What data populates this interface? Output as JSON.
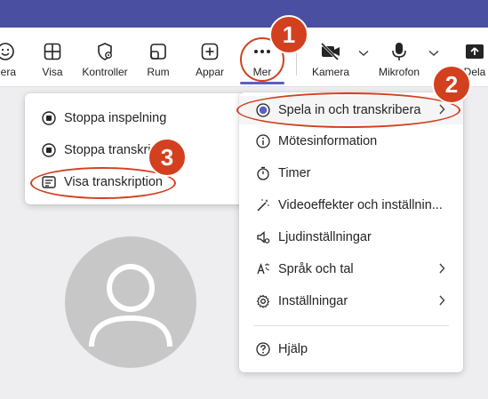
{
  "toolbar": {
    "items": [
      {
        "label": "gera",
        "icon": "reactions-icon"
      },
      {
        "label": "Visa",
        "icon": "grid-view-icon"
      },
      {
        "label": "Kontroller",
        "icon": "shield-settings-icon"
      },
      {
        "label": "Rum",
        "icon": "rooms-icon"
      },
      {
        "label": "Appar",
        "icon": "add-app-icon"
      },
      {
        "label": "Mer",
        "icon": "more-dots-icon"
      },
      {
        "label": "Kamera",
        "icon": "camera-off-icon"
      },
      {
        "label": "Mikrofon",
        "icon": "microphone-icon"
      },
      {
        "label": "Dela",
        "icon": "share-icon"
      }
    ]
  },
  "more_menu": {
    "items": [
      {
        "label": "Spela in och transkribera",
        "icon": "record-icon",
        "submenu": true
      },
      {
        "label": "Mötesinformation",
        "icon": "info-icon",
        "submenu": false
      },
      {
        "label": "Timer",
        "icon": "timer-icon",
        "submenu": false
      },
      {
        "label": "Videoeffekter och inställnin...",
        "icon": "magic-wand-icon",
        "submenu": false
      },
      {
        "label": "Ljudinställningar",
        "icon": "speaker-settings-icon",
        "submenu": false
      },
      {
        "label": "Språk och tal",
        "icon": "language-icon",
        "submenu": true
      },
      {
        "label": "Inställningar",
        "icon": "gear-icon",
        "submenu": true
      },
      {
        "label": "Hjälp",
        "icon": "help-icon",
        "submenu": false
      }
    ]
  },
  "record_submenu": {
    "items": [
      {
        "label": "Stoppa inspelning",
        "icon": "stop-record-icon"
      },
      {
        "label": "Stoppa transkri",
        "icon": "stop-record-icon"
      },
      {
        "label": "Visa transkription",
        "icon": "transcript-icon"
      }
    ]
  },
  "callouts": {
    "one": "1",
    "two": "2",
    "three": "3"
  },
  "colors": {
    "accent": "#5b5fc7",
    "header": "#4a4fa1",
    "callout": "#d2401f",
    "avatar": "#c7c7c7"
  }
}
